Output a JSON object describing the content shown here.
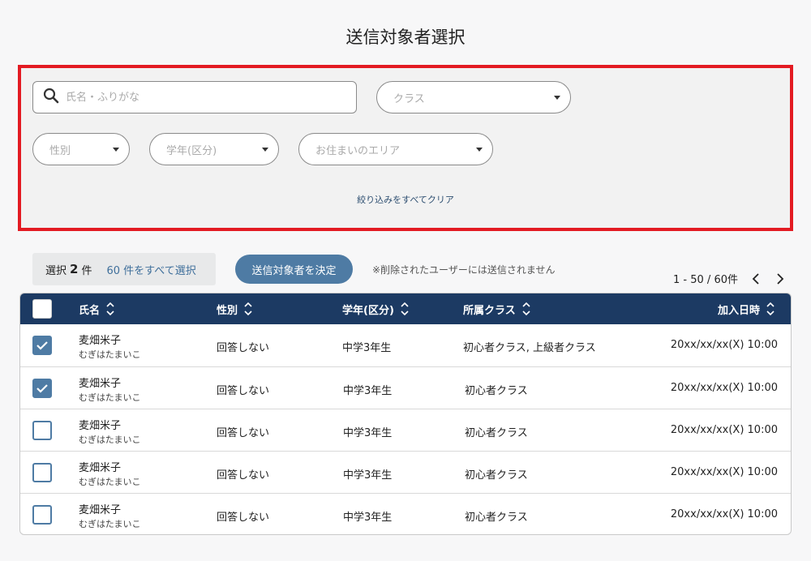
{
  "page_title": "送信対象者選択",
  "filters": {
    "search_placeholder": "氏名・ふりがな",
    "class_placeholder": "クラス",
    "gender_placeholder": "性別",
    "grade_placeholder": "学年(区分)",
    "area_placeholder": "お住まいのエリア",
    "clear_label": "絞り込みをすべてクリア"
  },
  "selection": {
    "prefix": "選択",
    "count": "2",
    "suffix": "件",
    "select_all_label": "60 件をすべて選択"
  },
  "decide_button_label": "送信対象者を決定",
  "notice": "※削除されたユーザーには送信されません",
  "pagination": {
    "range_text": "1 - 50 / 60件"
  },
  "table": {
    "headers": {
      "name": "氏名",
      "gender": "性別",
      "grade": "学年(区分)",
      "class": "所属クラス",
      "joined": "加入日時"
    },
    "rows": [
      {
        "name": "麦畑米子",
        "kana": "むぎはたまいこ",
        "gender": "回答しない",
        "grade": "中学3年生",
        "class": "初心者クラス, 上級者クラス",
        "joined": "20xx/xx/xx(X) 10:00",
        "checked": true
      },
      {
        "name": "麦畑米子",
        "kana": "むぎはたまいこ",
        "gender": "回答しない",
        "grade": "中学3年生",
        "class": "初心者クラス",
        "joined": "20xx/xx/xx(X) 10:00",
        "checked": true
      },
      {
        "name": "麦畑米子",
        "kana": "むぎはたまいこ",
        "gender": "回答しない",
        "grade": "中学3年生",
        "class": "初心者クラス",
        "joined": "20xx/xx/xx(X) 10:00",
        "checked": false
      },
      {
        "name": "麦畑米子",
        "kana": "むぎはたまいこ",
        "gender": "回答しない",
        "grade": "中学3年生",
        "class": "初心者クラス",
        "joined": "20xx/xx/xx(X) 10:00",
        "checked": false
      },
      {
        "name": "麦畑米子",
        "kana": "むぎはたまいこ",
        "gender": "回答しない",
        "grade": "中学3年生",
        "class": "初心者クラス",
        "joined": "20xx/xx/xx(X) 10:00",
        "checked": false
      }
    ]
  },
  "icons": {
    "search": "search-icon",
    "sort": "sort-icon",
    "prev": "chevron-left-icon",
    "next": "chevron-right-icon",
    "check": "checkmark-icon"
  },
  "colors": {
    "header_bg": "#1c3a63",
    "accent": "#4e7ba4",
    "highlight_border": "#e31b23"
  }
}
